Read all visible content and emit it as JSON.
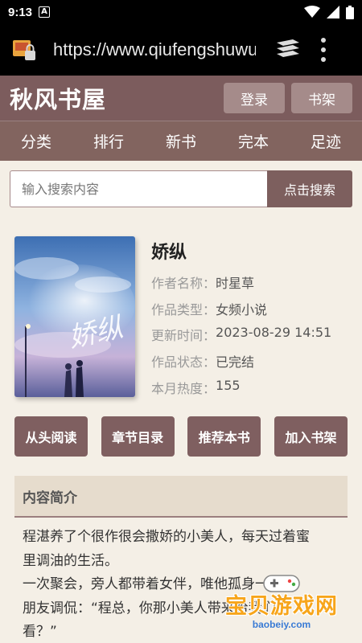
{
  "status_bar": {
    "time": "9:13",
    "notification_icon": "A"
  },
  "browser": {
    "url": "https://www.qiufengshuwu"
  },
  "site": {
    "title": "秋风书屋",
    "login_label": "登录",
    "bookshelf_label": "书架"
  },
  "nav": {
    "items": [
      "分类",
      "排行",
      "新书",
      "完本",
      "足迹"
    ]
  },
  "search": {
    "placeholder": "输入搜索内容",
    "button_label": "点击搜索"
  },
  "book": {
    "title": "娇纵",
    "cover_text": "娇纵",
    "meta": [
      {
        "key": "作者名称：",
        "value": "时星草"
      },
      {
        "key": "作品类型：",
        "value": "女频小说"
      },
      {
        "key": "更新时间：",
        "value": "2023-08-29 14:51"
      },
      {
        "key": "作品状态：",
        "value": "已完结"
      },
      {
        "key": "本月热度：",
        "value": "155"
      }
    ]
  },
  "actions": {
    "read_label": "从头阅读",
    "chapters_label": "章节目录",
    "recommend_label": "推荐本书",
    "add_label": "加入书架"
  },
  "intro": {
    "heading": "内容简介",
    "lines": [
      "程湛养了个很作很会撒娇的小美人，每天过着蜜",
      "里调油的生活。",
      "一次聚会，旁人都带着女伴，唯他孤身一人",
      "朋友调侃：“程总，你那小美人带来给我们",
      "看？”"
    ]
  },
  "watermark": {
    "text": "宝贝游戏网",
    "url": "baobeiy.com"
  },
  "colors": {
    "header": "#7c5c5d",
    "nav": "#82645f",
    "button": "#7f5f60",
    "background": "#f4efe6"
  }
}
